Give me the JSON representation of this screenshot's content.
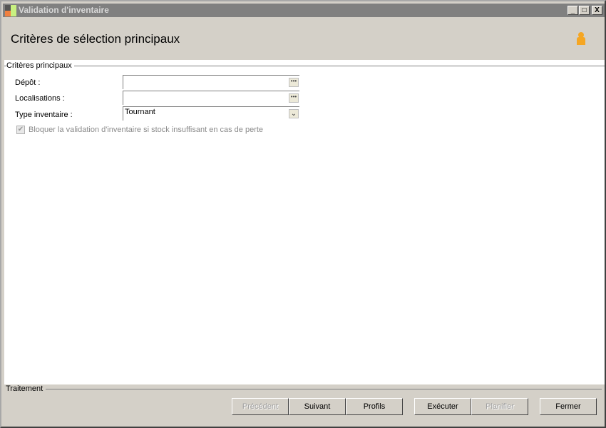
{
  "window": {
    "title": "Validation d'inventaire",
    "controls": [
      "_",
      "□",
      "X"
    ]
  },
  "header": {
    "title": "Critères de sélection principaux",
    "icon": "user-icon",
    "icon_color": "#f5a623"
  },
  "group": {
    "label": "Critères principaux"
  },
  "fields": [
    {
      "label": "Dépôt :",
      "value": ""
    },
    {
      "label": "Localisations :",
      "value": ""
    },
    {
      "label": "Type inventaire :",
      "value": "Tournant"
    }
  ],
  "checkbox": {
    "label": "Bloquer la validation d'inventaire si stock insuffisant en cas de  perte",
    "checked": true,
    "disabled": true
  },
  "footer": {
    "label": "Traitement",
    "buttons": {
      "previous": "Précédent",
      "next": "Suivant",
      "profiles": "Profils",
      "execute": "Exécuter",
      "schedule": "Planifier",
      "close": "Fermer"
    }
  }
}
